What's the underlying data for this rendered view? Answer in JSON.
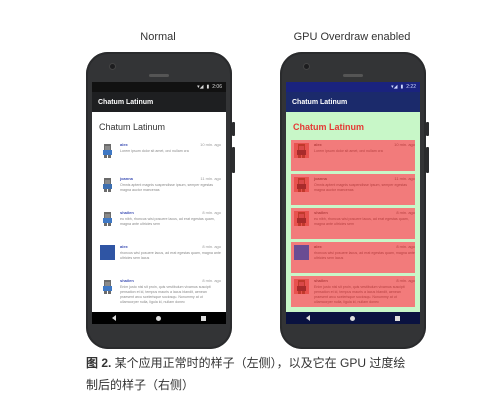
{
  "panels": [
    {
      "label": "Normal"
    },
    {
      "label": "GPU Overdraw enabled"
    }
  ],
  "phones": [
    {
      "status_time": "2:06",
      "app_title": "Chatum Latinum",
      "card_title": "Chatum Latinum",
      "messages": [
        {
          "name": "alex",
          "time": "10 min. ago",
          "text": "Lorem ipsum dolor sit amet, orci nullam cra"
        },
        {
          "name": "joanna",
          "time": "11 min. ago",
          "text": "Omnis aptent magnis suspendisse ipsum, semper egestas magna auctor maecenas"
        },
        {
          "name": "shailen",
          "time": "8 min. ago",
          "text": "eu nibh, rhoncus wisi posuere lacus, ad erat egestas quam, magna ante ultricies sem"
        },
        {
          "name": "alex",
          "time": "8 min. ago",
          "text": "rhoncus wisi posuere lacus, ad erat egestas quam, magna ante ultricies sem lacus"
        },
        {
          "name": "shailen",
          "time": "8 min. ago",
          "text": "Enim justo nisl sit proin, quis vestibulum vivamus suscipit pensation et id, tempus mauris a lacus blandit, aenean praesent arcu scelerisque sociosqu. Nonummy at ut ullamcorper nulla, ligula id, nullam donec"
        }
      ]
    },
    {
      "status_time": "2:22",
      "app_title": "Chatum Latinum",
      "card_title": "Chatum Latinum",
      "messages": [
        {
          "name": "alex",
          "time": "10 min. ago",
          "text": "Lorem ipsum dolor sit amet, orci nullam cra"
        },
        {
          "name": "joanna",
          "time": "11 min. ago",
          "text": "Omnis aptent magnis suspendisse ipsum, semper egestas magna auctor maecenas"
        },
        {
          "name": "shailen",
          "time": "8 min. ago",
          "text": "eu nibh, rhoncus wisi posuere lacus, ad erat egestas quam, magna ante ultricies sem"
        },
        {
          "name": "alex",
          "time": "8 min. ago",
          "text": "rhoncus wisi posuere lacus, ad erat egestas quam, magna ante ultricies sem lacus"
        },
        {
          "name": "shailen",
          "time": "8 min. ago",
          "text": "Enim justo nisl sit proin, quis vestibulum vivamus suscipit pensation et id, tempus mauris a lacus blandit, aenean praesent arcu scelerisque sociosqu. Nonummy at ut ullamcorper nulla, ligula id, nullam donec"
        }
      ]
    }
  ],
  "caption": {
    "label": "图 2.",
    "text": " 某个应用正常时的样子（左侧），以及它在 GPU 过度绘制后的样子（右侧）"
  },
  "colors": {
    "overdraw_green": "#c8f7c8",
    "overdraw_red": "#f27b7b",
    "app_bar_normal": "#1e1f21",
    "app_bar_overdraw": "#1b2a6b"
  }
}
